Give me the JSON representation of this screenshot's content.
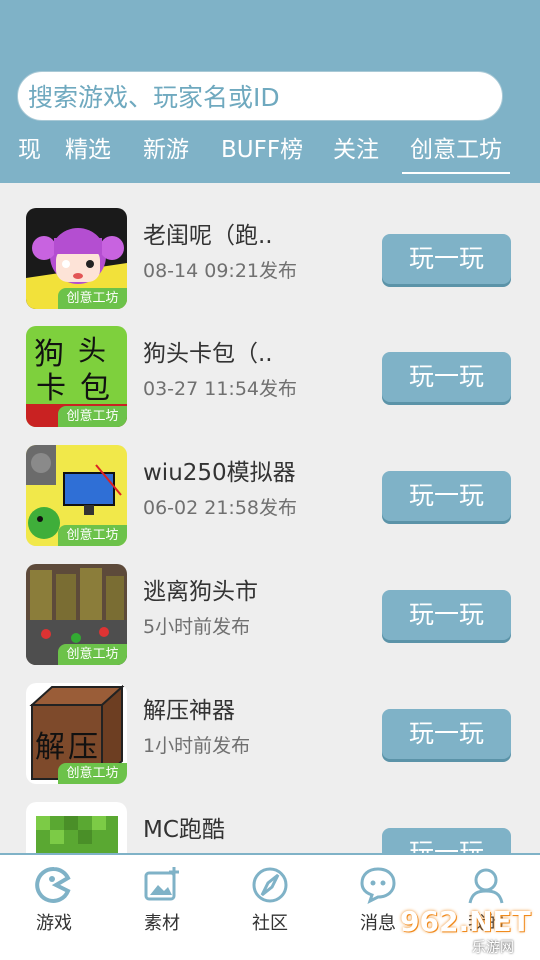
{
  "search": {
    "placeholder": "搜索游戏、玩家名或ID"
  },
  "tabs": [
    {
      "label": "现"
    },
    {
      "label": "精选"
    },
    {
      "label": "新游"
    },
    {
      "label": "BUFF榜"
    },
    {
      "label": "关注"
    },
    {
      "label": "创意工坊",
      "active": true
    }
  ],
  "badge_label": "创意工坊",
  "play_label": "玩一玩",
  "games": [
    {
      "title": "老闺呢（跑..",
      "time": "08-14 09:21发布"
    },
    {
      "title": "狗头卡包（..",
      "time": "03-27 11:54发布"
    },
    {
      "title": "wiu250模拟器",
      "time": "06-02 21:58发布"
    },
    {
      "title": "逃离狗头市",
      "time": "5小时前发布"
    },
    {
      "title": "解压神器",
      "time": "1小时前发布"
    },
    {
      "title": "MC跑酷",
      "time": ""
    }
  ],
  "nav": [
    {
      "label": "游戏",
      "icon": "game-icon"
    },
    {
      "label": "素材",
      "icon": "image-add-icon"
    },
    {
      "label": "社区",
      "icon": "compass-icon"
    },
    {
      "label": "消息",
      "icon": "chat-icon"
    },
    {
      "label": "我的",
      "icon": "profile-icon"
    }
  ],
  "thumb_text": {
    "game2": [
      "狗",
      "头",
      "卡",
      "包"
    ],
    "game5": [
      "解",
      "压"
    ]
  },
  "watermark": {
    "logo": "962.NET",
    "sub": "乐游网"
  },
  "colors": {
    "header": "#7fb2c7",
    "badge": "#6cc24a",
    "button": "#7fb2c7"
  }
}
